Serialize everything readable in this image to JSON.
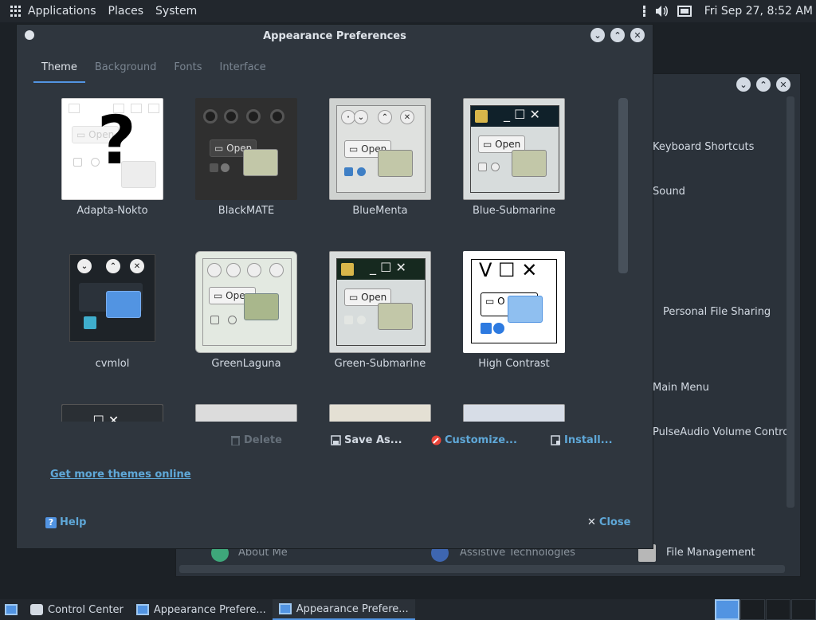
{
  "top_panel": {
    "menus": [
      "Applications",
      "Places",
      "System"
    ],
    "clock": "Fri Sep 27,  8:52 AM"
  },
  "bg_window": {
    "items": [
      "Keyboard Shortcuts",
      "Sound",
      "Personal File Sharing",
      "Main Menu",
      "PulseAudio Volume Control",
      "About Me",
      "Assistive Technologies",
      "File Management"
    ]
  },
  "dialog": {
    "title": "Appearance Preferences",
    "tabs": [
      "Theme",
      "Background",
      "Fonts",
      "Interface"
    ],
    "themes": [
      "Adapta-Nokto",
      "BlackMATE",
      "BlueMenta",
      "Blue-Submarine",
      "cvmlol",
      "GreenLaguna",
      "Green-Submarine",
      "High Contrast"
    ],
    "actions": {
      "delete": "Delete",
      "save_as": "Save As...",
      "customize": "Customize...",
      "install": "Install..."
    },
    "get_more": "Get more themes online",
    "help": "Help",
    "close": "Close"
  },
  "taskbar": {
    "tasks": [
      "Control Center",
      "Appearance Prefere...",
      "Appearance Prefere..."
    ]
  },
  "colors": {
    "accent": "#5294e2",
    "link": "#5fa8d8",
    "dialog_bg": "#2f363e"
  }
}
